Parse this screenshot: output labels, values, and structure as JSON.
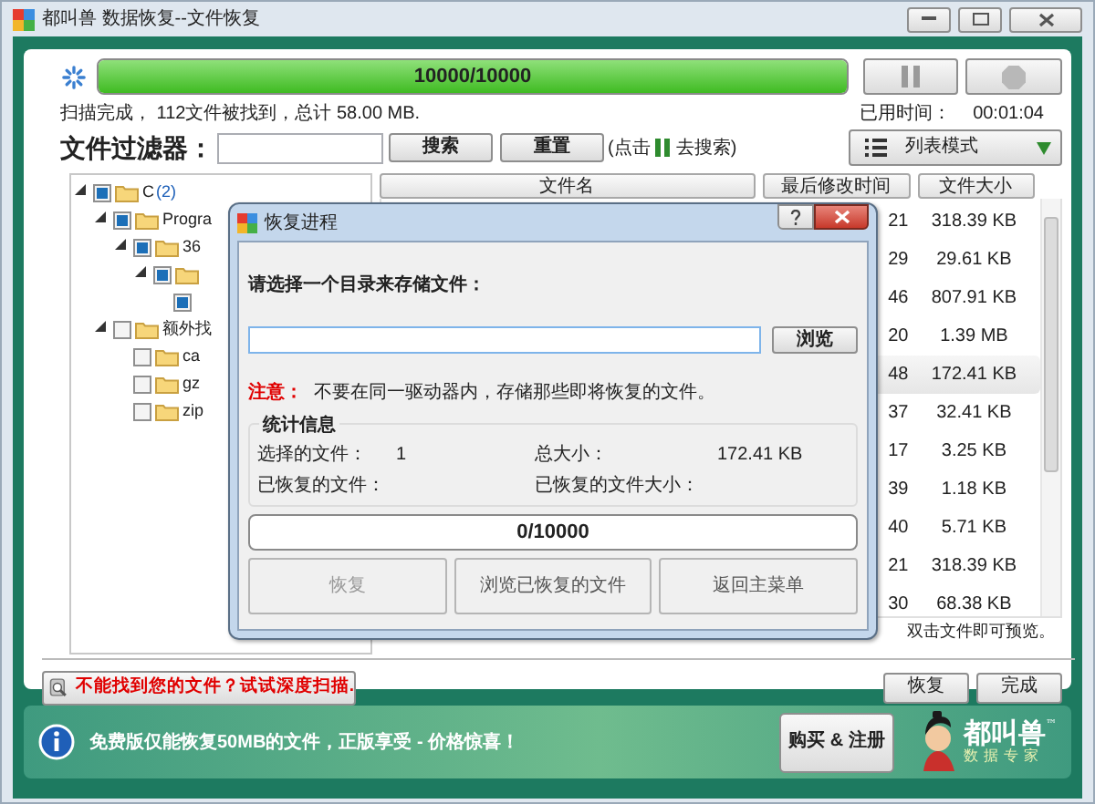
{
  "window": {
    "title": "都叫兽 数据恢复--文件恢复"
  },
  "scan": {
    "level": 1,
    "progress_text": "10000/10000",
    "status": "扫描完成， 112文件被找到，总计 58.00 MB.",
    "elapsed_label": "已用时间：",
    "elapsed": "00:01:04"
  },
  "filter": {
    "label": "文件过滤器：",
    "search_button": "搜索",
    "reset_button": "重置",
    "hint_before": "(点击",
    "hint_after": "去搜索)",
    "view_mode": "列表模式"
  },
  "tree": [
    {
      "kind": "folder",
      "label": "C",
      "count": "(2)",
      "checked": true,
      "expanded": true,
      "children": [
        {
          "kind": "folder",
          "label": "Progra",
          "checked": true,
          "expanded": true,
          "children": [
            {
              "kind": "folder",
              "label": "36",
              "checked": true,
              "expanded": true,
              "children": [
                {
                  "kind": "folder",
                  "checked": true,
                  "expanded": true,
                  "children": [
                    {
                      "checked": true
                    }
                  ]
                }
              ]
            }
          ]
        },
        {
          "kind": "folder",
          "label": "额外找",
          "checked": false,
          "expanded": true,
          "children": [
            {
              "kind": "folder",
              "label": "ca",
              "checked": false
            },
            {
              "kind": "folder",
              "label": "gz",
              "checked": false
            },
            {
              "kind": "folder",
              "label": "zip",
              "checked": false
            }
          ]
        }
      ]
    }
  ],
  "file_list": {
    "columns": [
      "文件名",
      "最后修改时间",
      "文件大小"
    ],
    "rows": [
      {
        "time": "21",
        "size": "318.39 KB",
        "selected": false
      },
      {
        "time": "29",
        "size": "29.61 KB",
        "selected": false
      },
      {
        "time": "46",
        "size": "807.91 KB",
        "selected": false
      },
      {
        "time": "20",
        "size": "1.39 MB",
        "selected": false
      },
      {
        "time": "48",
        "size": "172.41 KB",
        "selected": true
      },
      {
        "time": "37",
        "size": "32.41 KB",
        "selected": false
      },
      {
        "time": "17",
        "size": "3.25 KB",
        "selected": false
      },
      {
        "time": "39",
        "size": "1.18 KB",
        "selected": false
      },
      {
        "time": "40",
        "size": "5.71 KB",
        "selected": false
      },
      {
        "time": "21",
        "size": "318.39 KB",
        "selected": false
      },
      {
        "time": "30",
        "size": "68.38 KB",
        "selected": false
      }
    ],
    "hint": "双击文件即可预览。"
  },
  "bottom": {
    "deep_scan": "不能找到您的文件？试试深度扫描.",
    "buttons": [
      "恢复",
      "完成"
    ]
  },
  "banner": {
    "message": "免费版仅能恢复50MB的文件，正版享受 - 价格惊喜！",
    "buy_button": "购买 & 注册",
    "logo_name": "都叫兽",
    "logo_tagline": "数据专家",
    "trademark": "™"
  },
  "dialog": {
    "title": "恢复进程",
    "prompt": "请选择一个目录来存储文件：",
    "browse_button": "浏览",
    "note_label": "注意：",
    "note": "不要在同一驱动器内，存储那些即将恢复的文件。",
    "stats_title": "统计信息",
    "stats": [
      {
        "label": "选择的文件：",
        "value": "1"
      },
      {
        "label": "总大小：",
        "value": "172.41 KB"
      },
      {
        "label": "已恢复的文件："
      },
      {
        "label": "已恢复的文件大小："
      }
    ],
    "progress_text": "0/10000",
    "level": 0,
    "buttons": [
      {
        "label": "恢复",
        "disabled": true
      },
      {
        "label": "浏览已恢复的文件",
        "disabled": false
      },
      {
        "label": "返回主菜单",
        "disabled": false
      }
    ]
  }
}
